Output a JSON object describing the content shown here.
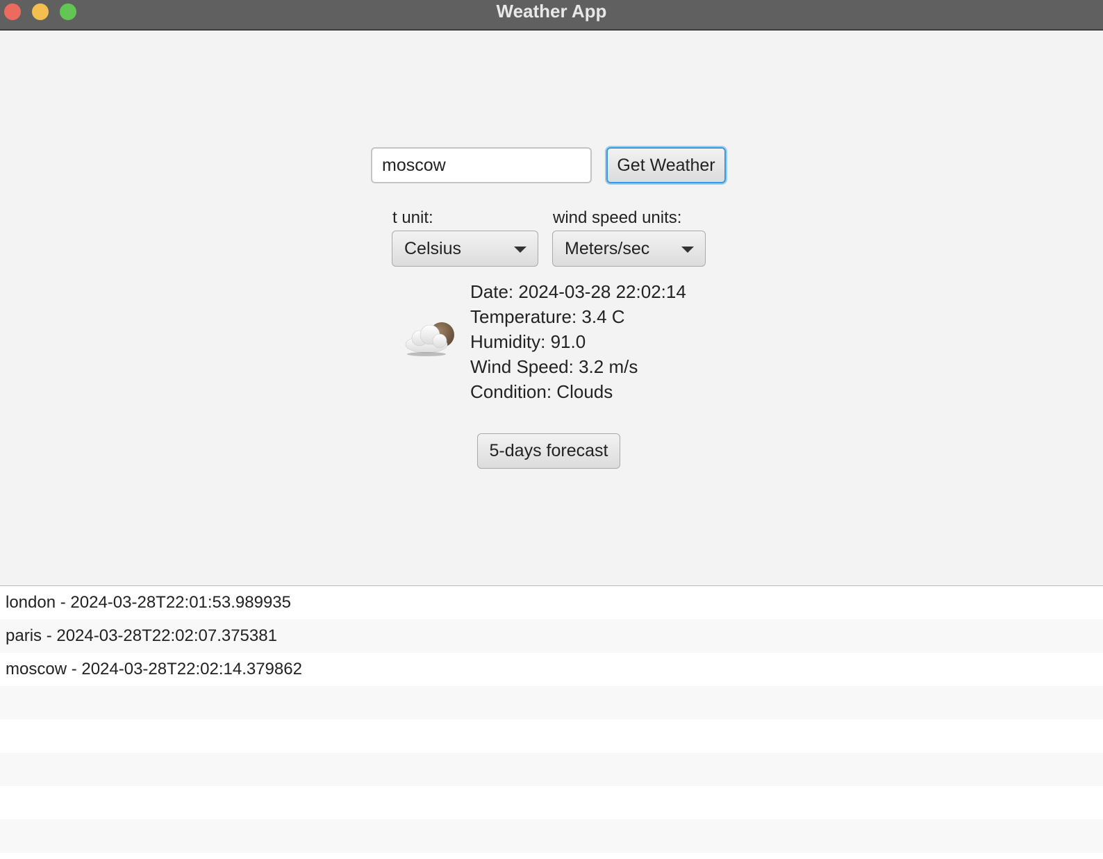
{
  "window": {
    "title": "Weather App"
  },
  "search": {
    "value": "moscow",
    "button_label": "Get Weather"
  },
  "units": {
    "temp_label": "t unit:",
    "temp_selected": "Celsius",
    "wind_label": "wind speed units:",
    "wind_selected": "Meters/sec"
  },
  "current": {
    "icon": "cloud-moon-icon",
    "date": "Date: 2024-03-28 22:02:14",
    "temperature": "Temperature: 3.4 C",
    "humidity": "Humidity: 91.0",
    "wind_speed": "Wind Speed: 3.2 m/s",
    "condition": "Condition: Clouds"
  },
  "forecast_button": "5-days forecast",
  "history": [
    "london - 2024-03-28T22:01:53.989935",
    "paris - 2024-03-28T22:02:07.375381",
    "moscow - 2024-03-28T22:02:14.379862"
  ],
  "colors": {
    "focus": "#3e97d6",
    "close": "#ed6a5e",
    "minimize": "#f5bf4f",
    "maximize": "#62c554"
  }
}
